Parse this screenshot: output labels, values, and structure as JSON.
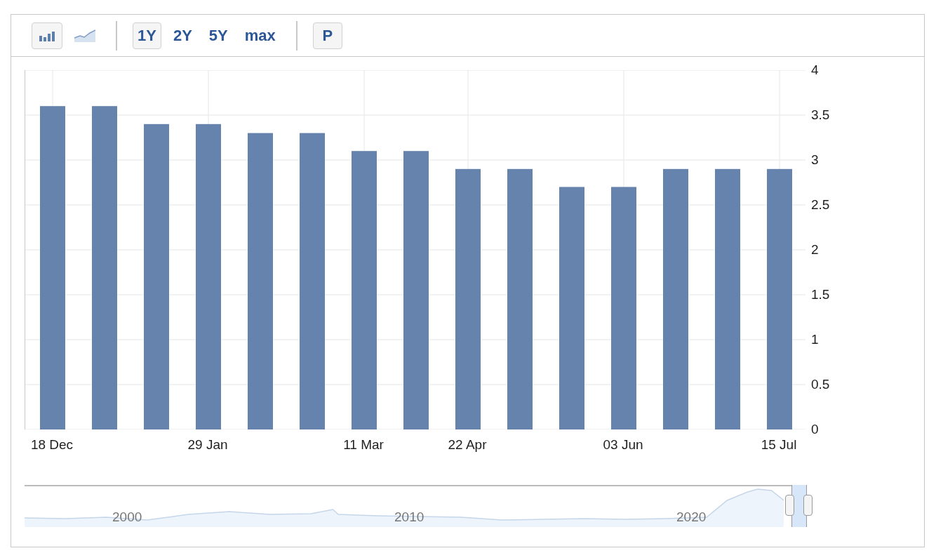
{
  "toolbar": {
    "chart_types": [
      {
        "kind": "bar",
        "selected": true
      },
      {
        "kind": "area",
        "selected": false
      }
    ],
    "ranges": [
      {
        "label": "1Y",
        "selected": true
      },
      {
        "label": "2Y",
        "selected": false
      },
      {
        "label": "5Y",
        "selected": false
      },
      {
        "label": "max",
        "selected": false
      }
    ],
    "extra_button": {
      "label": "P"
    }
  },
  "chart": {
    "chart_data": {
      "type": "bar",
      "grid": true,
      "categories": [
        "18 Dec",
        null,
        null,
        "29 Jan",
        null,
        null,
        "11 Mar",
        null,
        "22 Apr",
        null,
        null,
        "03 Jun",
        null,
        null,
        "15 Jul"
      ],
      "values": [
        3.6,
        3.6,
        3.4,
        3.4,
        3.3,
        3.3,
        3.1,
        3.1,
        2.9,
        2.9,
        2.7,
        2.7,
        2.9,
        2.9,
        2.9
      ],
      "ylim": [
        0,
        4
      ],
      "yticks": [
        0,
        0.5,
        1,
        1.5,
        2,
        2.5,
        3,
        3.5,
        4
      ]
    }
  },
  "navigator": {
    "years": [
      "2000",
      "2010",
      "2020"
    ]
  }
}
